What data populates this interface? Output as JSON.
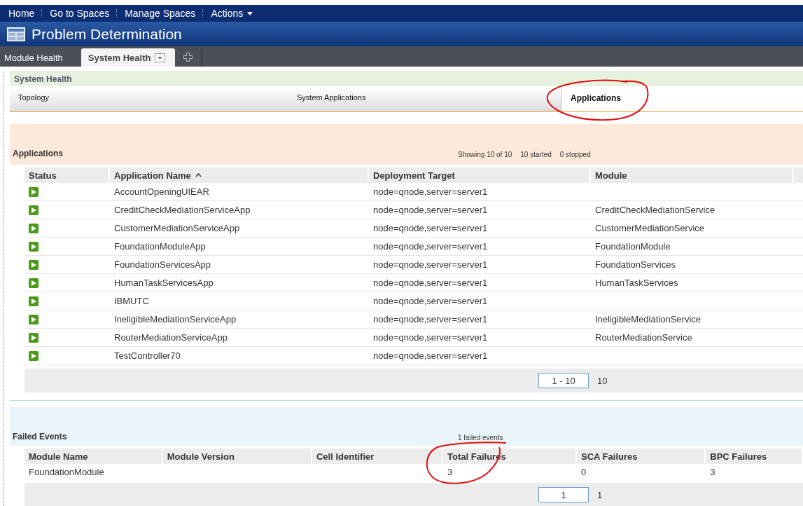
{
  "top_nav": {
    "items": [
      {
        "label": "Home",
        "kind": "link"
      },
      {
        "label": "Go to Spaces",
        "kind": "link"
      },
      {
        "label": "Manage Spaces",
        "kind": "link"
      },
      {
        "label": "Actions",
        "kind": "menu"
      }
    ]
  },
  "title_bar": {
    "title": "Problem Determination"
  },
  "page_tabs": [
    {
      "label": "Module Health",
      "selected": false
    },
    {
      "label": "System Health",
      "selected": true
    }
  ],
  "panel": {
    "title": "System Health",
    "subtabs": [
      {
        "label": "Topology",
        "selected": false,
        "circled": false
      },
      {
        "label": "System Applications",
        "selected": false,
        "circled": false
      },
      {
        "label": "Applications",
        "selected": true,
        "circled": true
      }
    ]
  },
  "applications": {
    "title": "Applications",
    "summary": [
      "Showing 10 of 10",
      "10 started",
      "0 stopped"
    ],
    "columns": [
      {
        "label": "Status",
        "sorted": false
      },
      {
        "label": "Application Name",
        "sorted": true
      },
      {
        "label": "Deployment Target",
        "sorted": false
      },
      {
        "label": "Module",
        "sorted": false
      }
    ],
    "rows": [
      {
        "running": true,
        "name": "AccountOpeningUIEAR",
        "target": "node=qnode,server=server1",
        "module": ""
      },
      {
        "running": true,
        "name": "CreditCheckMediationServiceApp",
        "target": "node=qnode,server=server1",
        "module": "CreditCheckMediationService"
      },
      {
        "running": true,
        "name": "CustomerMediationServiceApp",
        "target": "node=qnode,server=server1",
        "module": "CustomerMediationService"
      },
      {
        "running": true,
        "name": "FoundationModuleApp",
        "target": "node=qnode,server=server1",
        "module": "FoundationModule"
      },
      {
        "running": true,
        "name": "FoundationServicesApp",
        "target": "node=qnode,server=server1",
        "module": "FoundationServices"
      },
      {
        "running": true,
        "name": "HumanTaskServicesApp",
        "target": "node=qnode,server=server1",
        "module": "HumanTaskServices"
      },
      {
        "running": true,
        "name": "IBMUTC",
        "target": "node=qnode,server=server1",
        "module": ""
      },
      {
        "running": true,
        "name": "IneligibleMediationServiceApp",
        "target": "node=qnode,server=server1",
        "module": "IneligibleMediationService"
      },
      {
        "running": true,
        "name": "RouterMediationServiceApp",
        "target": "node=qnode,server=server1",
        "module": "RouterMediationService"
      },
      {
        "running": true,
        "name": "TestController70",
        "target": "node=qnode,server=server1",
        "module": ""
      }
    ],
    "pager": {
      "range": "1 - 10",
      "total": "10"
    }
  },
  "failed_events": {
    "title": "Failed Events",
    "summary": "1 failed events",
    "columns": [
      {
        "label": "Module Name",
        "circled": false
      },
      {
        "label": "Module Version",
        "circled": false
      },
      {
        "label": "Cell Identifier",
        "circled": false
      },
      {
        "label": "Total Failures",
        "circled": true
      },
      {
        "label": "SCA Failures",
        "circled": false
      },
      {
        "label": "BPC Failures",
        "circled": false
      }
    ],
    "rows": [
      [
        "FoundationModule",
        "",
        "",
        "3",
        "0",
        "3"
      ]
    ],
    "pager": {
      "range": "1",
      "total": "1"
    }
  }
}
